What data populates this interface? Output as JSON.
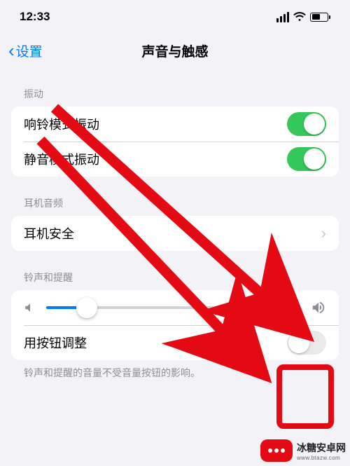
{
  "status": {
    "time": "12:33"
  },
  "nav": {
    "back": "设置",
    "title": "声音与触感"
  },
  "sections": {
    "vibrate": {
      "header": "振动",
      "ring": {
        "label": "响铃模式振动",
        "on": true
      },
      "silent": {
        "label": "静音模式振动",
        "on": true
      }
    },
    "headphone": {
      "header": "耳机音频",
      "safety": "耳机安全"
    },
    "ringer": {
      "header": "铃声和提醒",
      "volume_percent": 16,
      "change_with_buttons": {
        "label": "用按钮调整",
        "on": false
      },
      "footer": "铃声和提醒的音量不受音量按钮的影响。"
    }
  },
  "watermark": {
    "name": "冰糖安卓网",
    "url": "www.btazw.com"
  }
}
